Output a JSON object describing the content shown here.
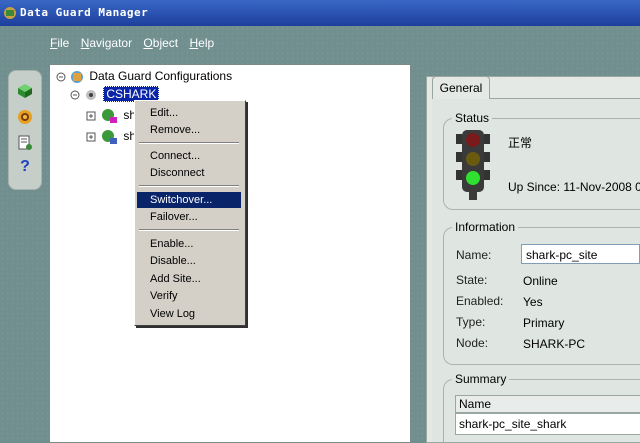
{
  "window": {
    "title": "Data Guard Manager"
  },
  "menu": [
    {
      "label": "File",
      "mnemonic": "F",
      "rest": "ile"
    },
    {
      "label": "Navigator",
      "mnemonic": "N",
      "rest": "avigator"
    },
    {
      "label": "Object",
      "mnemonic": "O",
      "rest": "bject"
    },
    {
      "label": "Help",
      "mnemonic": "H",
      "rest": "elp"
    }
  ],
  "toolbar": {
    "icons": [
      "cube-icon",
      "target-icon",
      "properties-icon",
      "help-icon"
    ],
    "help_glyph": "?"
  },
  "tree": {
    "root_label": "Data Guard Configurations",
    "config_label": "CSHARK",
    "site1_label": "sh",
    "site2_label": "sh"
  },
  "context_menu": {
    "items": [
      "Edit...",
      "Remove...",
      "Connect...",
      "Disconnect",
      "Switchover...",
      "Failover...",
      "Enable...",
      "Disable...",
      "Add Site...",
      "Verify",
      "View Log"
    ],
    "highlighted": "Switchover..."
  },
  "right_panel": {
    "tab_label": "General",
    "status": {
      "group_title": "Status",
      "value": "正常",
      "up_since": "Up Since: 11-Nov-2008 0"
    },
    "information": {
      "group_title": "Information",
      "name_label": "Name:",
      "name_value": "shark-pc_site",
      "state_label": "State:",
      "state_value": "Online",
      "enabled_label": "Enabled:",
      "enabled_value": "Yes",
      "type_label": "Type:",
      "type_value": "Primary",
      "node_label": "Node:",
      "node_value": "SHARK-PC"
    },
    "summary": {
      "group_title": "Summary",
      "column_header": "Name",
      "rows": [
        "shark-pc_site_shark"
      ]
    }
  },
  "colors": {
    "title_bar": "#1c3f9c",
    "selection": "#0a24a8",
    "menu_highlight": "#0a246a",
    "workspace": "#718f8f"
  }
}
